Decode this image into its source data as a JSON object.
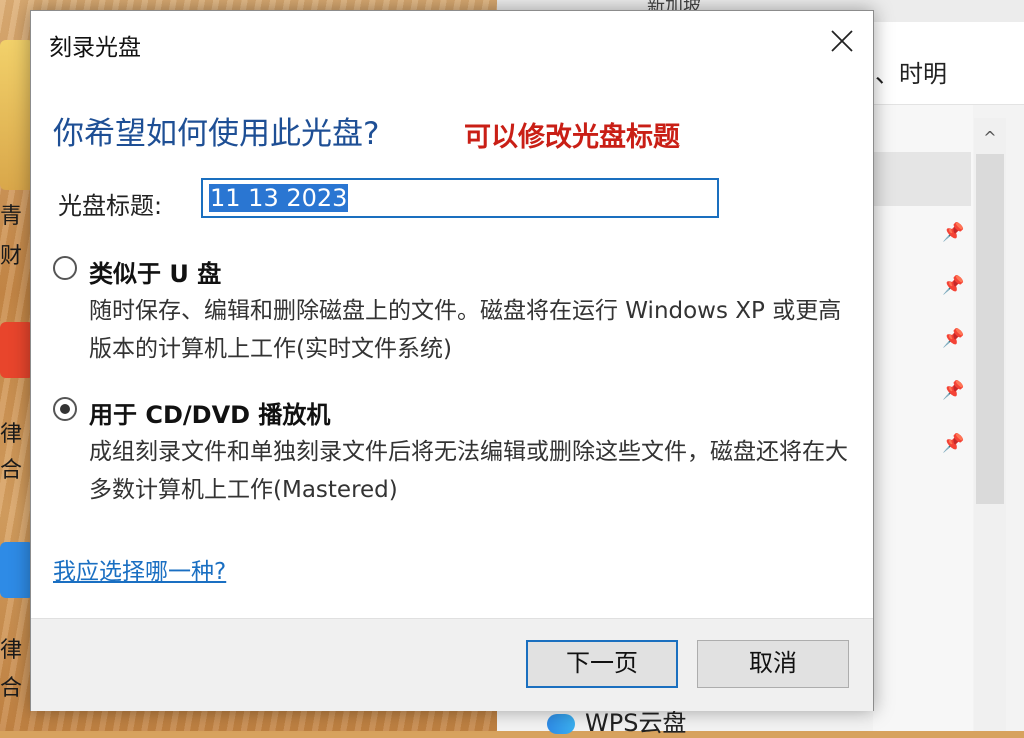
{
  "background": {
    "desktop_text": [
      "青",
      "财",
      "律",
      "合",
      "律",
      "合"
    ],
    "explorer_top_text": "新加坡",
    "explorer_crumb": "、时明",
    "wps_label": "WPS云盘",
    "scroll_up_glyph": "^",
    "pin_glyph": "📌",
    "colors": {
      "desktop": "#d7a25e",
      "accent_red": "#e8452c",
      "accent_blue": "#2e8be6"
    }
  },
  "dialog": {
    "title": "刻录光盘",
    "close_glyph": "×",
    "heading": "你希望如何使用此光盘?",
    "annotation": "可以修改光盘标题",
    "disc_title_label": "光盘标题:",
    "disc_title_value": "11 13 2023",
    "options": [
      {
        "title": "类似于 U 盘",
        "description": "随时保存、编辑和删除磁盘上的文件。磁盘将在运行 Windows XP 或更高版本的计算机上工作(实时文件系统)",
        "checked": false
      },
      {
        "title": "用于 CD/DVD 播放机",
        "description": "成组刻录文件和单独刻录文件后将无法编辑或删除这些文件，磁盘还将在大多数计算机上工作(Mastered)",
        "checked": true
      }
    ],
    "help_link": "我应选择哪一种?",
    "buttons": {
      "next": "下一页",
      "cancel": "取消"
    },
    "colors": {
      "heading": "#1e4f95",
      "annotation": "#c91f16",
      "link": "#1a6fc2",
      "focus": "#1a6fbf"
    }
  }
}
